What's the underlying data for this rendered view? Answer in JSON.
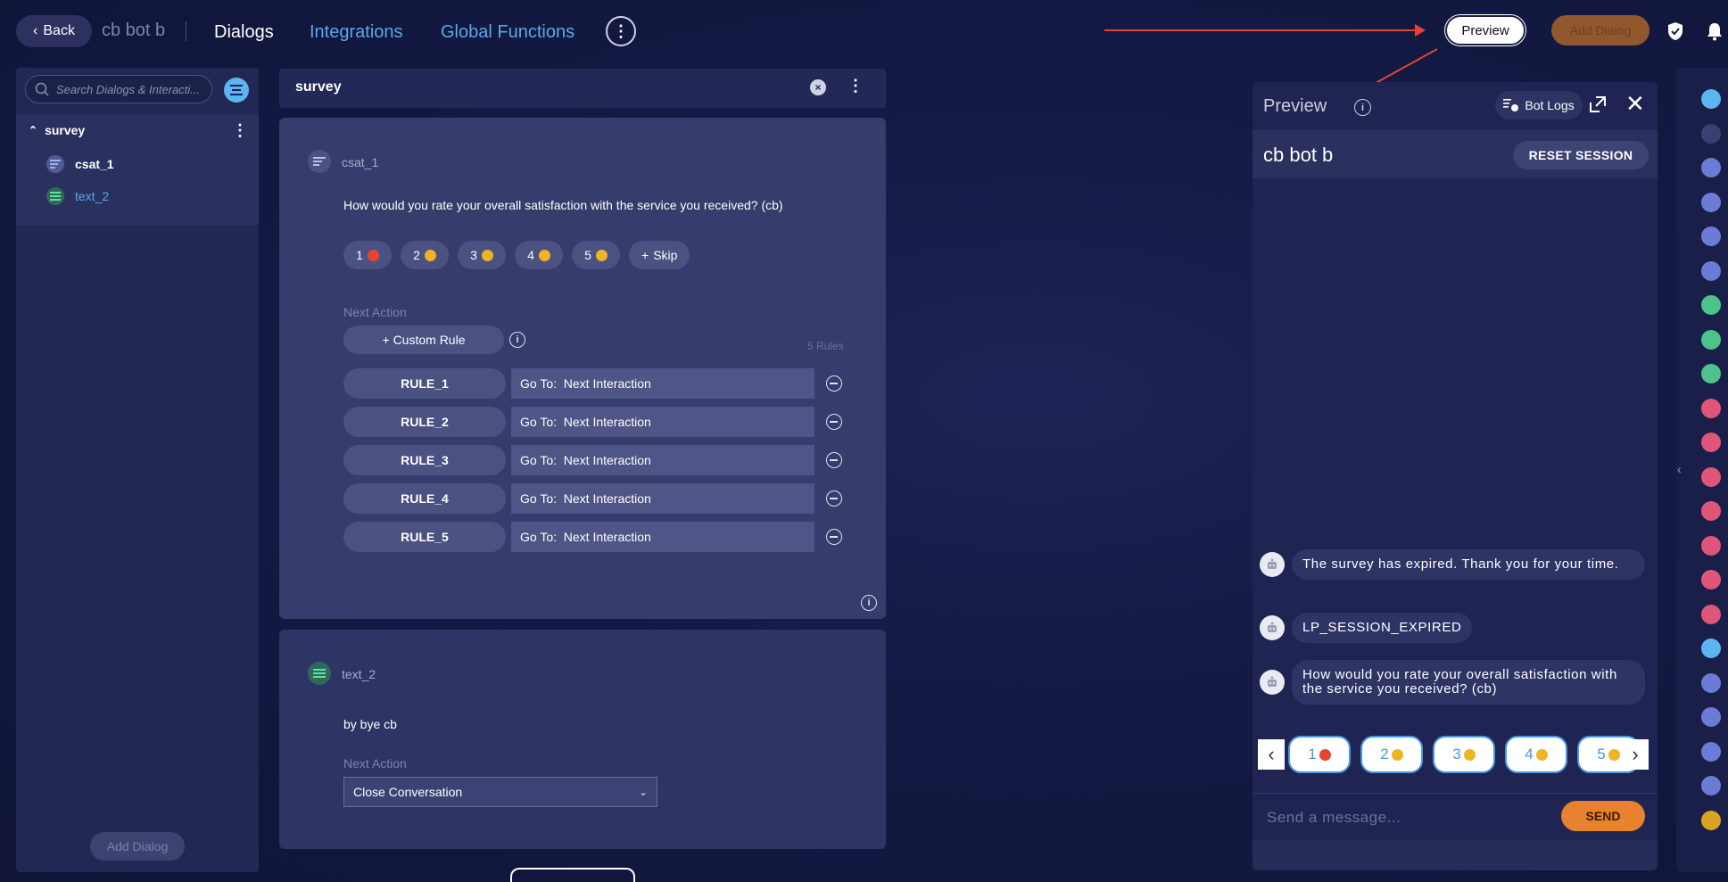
{
  "topbar": {
    "back_label": "Back",
    "bot_name": "cb bot b",
    "nav": {
      "dialogs": "Dialogs",
      "integrations": "Integrations",
      "global_functions": "Global Functions"
    },
    "preview_label": "Preview",
    "add_dialog_label": "Add Dialog",
    "accent_red": "#e2452f"
  },
  "sidebar": {
    "search_placeholder": "Search Dialogs & Interacti...",
    "group": {
      "name": "survey"
    },
    "items": [
      {
        "label": "csat_1",
        "icon": "csat-icon"
      },
      {
        "label": "text_2",
        "icon": "text-icon"
      }
    ],
    "add_dialog_label": "Add Dialog"
  },
  "dialog": {
    "title": "survey",
    "csat": {
      "label": "csat_1",
      "question": "How would you rate your overall satisfaction with the service you received? (cb)",
      "quick_replies": [
        {
          "label": "1",
          "emoji_color": "#e8442f"
        },
        {
          "label": "2",
          "emoji_color": "#f0b324"
        },
        {
          "label": "3",
          "emoji_color": "#f0b324"
        },
        {
          "label": "4",
          "emoji_color": "#f0b324"
        },
        {
          "label": "5",
          "emoji_color": "#f0b324"
        }
      ],
      "skip_label": "Skip",
      "next_action_label": "Next Action",
      "custom_rule_label": "+ Custom Rule",
      "rules_count": "5 Rules",
      "rules": [
        {
          "name": "RULE_1",
          "goto_prefix": "Go To:",
          "goto_target": "Next Interaction"
        },
        {
          "name": "RULE_2",
          "goto_prefix": "Go To:",
          "goto_target": "Next Interaction"
        },
        {
          "name": "RULE_3",
          "goto_prefix": "Go To:",
          "goto_target": "Next Interaction"
        },
        {
          "name": "RULE_4",
          "goto_prefix": "Go To:",
          "goto_target": "Next Interaction"
        },
        {
          "name": "RULE_5",
          "goto_prefix": "Go To:",
          "goto_target": "Next Interaction"
        }
      ]
    },
    "text": {
      "label": "text_2",
      "body": "by bye cb",
      "next_action_label": "Next Action",
      "next_action_value": "Close Conversation"
    }
  },
  "preview": {
    "title": "Preview",
    "bot_logs_label": "Bot Logs",
    "bot_name": "cb bot b",
    "reset_label": "RESET SESSION",
    "messages": [
      {
        "text": "The survey has expired. Thank you for your time."
      },
      {
        "text": "LP_SESSION_EXPIRED"
      },
      {
        "text": "How would you rate your overall satisfaction with the service you received? (cb)"
      }
    ],
    "quick_replies": [
      "1",
      "2",
      "3",
      "4",
      "5"
    ],
    "input_placeholder": "Send a message...",
    "send_label": "SEND",
    "send_color": "#e8822e"
  },
  "rail": {
    "icons": [
      "chat-bubble-icon",
      "menu-icon",
      "list-icon",
      "grid-icon",
      "bolt-icon",
      "question-icon",
      "text-icon",
      "image-icon",
      "link-icon",
      "record-icon",
      "question-icon",
      "card-icon",
      "list-icon",
      "bolt-icon",
      "form-icon",
      "calendar-icon",
      "cloud-icon",
      "payment-icon",
      "chat-icon",
      "faq-icon",
      "bot-icon",
      "coin-icon"
    ]
  }
}
